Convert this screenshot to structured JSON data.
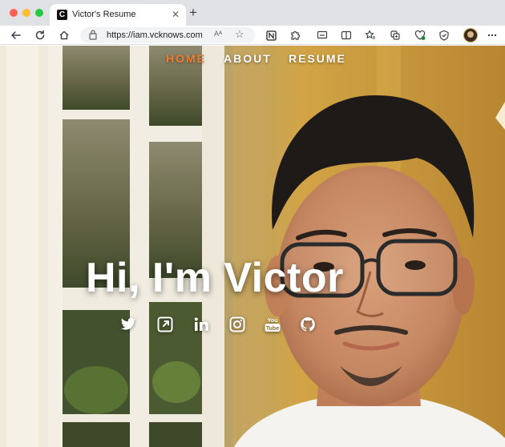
{
  "browser": {
    "tab": {
      "title": "Victor's Resume",
      "favicon_letter": "C",
      "close_glyph": "✕"
    },
    "new_tab_glyph": "+",
    "address": {
      "url": "https://iam.vcknows.com",
      "reader_glyph": "Aᴬ",
      "star_glyph": "☆"
    },
    "nav_icons": [
      "back-icon",
      "reload-icon",
      "home-icon"
    ],
    "toolbar_icons": [
      "notion-icon",
      "extension-icon",
      "cast-icon",
      "split-screen-icon",
      "favorites-icon",
      "collections-icon",
      "health-icon",
      "browser-essentials-icon"
    ]
  },
  "site": {
    "nav": {
      "home": "HOME",
      "about": "ABOUT",
      "resume": "RESUME"
    },
    "headline": "Hi, I'm Victor",
    "social": [
      "twitter-icon",
      "external-link-icon",
      "linkedin-icon",
      "instagram-icon",
      "youtube-icon",
      "github-icon"
    ],
    "colors": {
      "nav_active": "#f07b2c",
      "nav_text": "#ffffff",
      "headline": "#ffffff"
    }
  }
}
